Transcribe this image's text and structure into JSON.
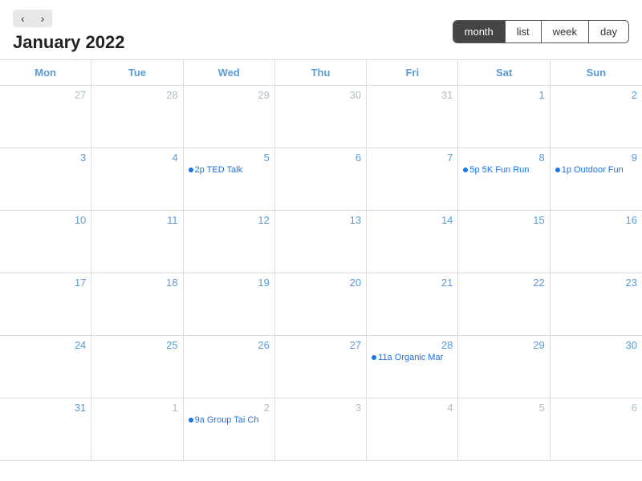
{
  "header": {
    "title": "January 2022",
    "nav": {
      "prev_label": "‹",
      "next_label": "›"
    },
    "view_buttons": [
      {
        "id": "month",
        "label": "month",
        "active": true
      },
      {
        "id": "list",
        "label": "list",
        "active": false
      },
      {
        "id": "week",
        "label": "week",
        "active": false
      },
      {
        "id": "day",
        "label": "day",
        "active": false
      }
    ]
  },
  "calendar": {
    "day_headers": [
      "Mon",
      "Tue",
      "Wed",
      "Thu",
      "Fri",
      "Sat",
      "Sun"
    ],
    "weeks": [
      [
        {
          "day": "27",
          "other": true,
          "events": []
        },
        {
          "day": "28",
          "other": true,
          "events": []
        },
        {
          "day": "29",
          "other": true,
          "events": []
        },
        {
          "day": "30",
          "other": true,
          "events": []
        },
        {
          "day": "31",
          "other": true,
          "events": []
        },
        {
          "day": "1",
          "other": false,
          "events": []
        },
        {
          "day": "2",
          "other": false,
          "events": []
        }
      ],
      [
        {
          "day": "3",
          "other": false,
          "events": []
        },
        {
          "day": "4",
          "other": false,
          "events": []
        },
        {
          "day": "5",
          "other": false,
          "events": [
            {
              "time": "2p",
              "name": "TED Talk"
            }
          ]
        },
        {
          "day": "6",
          "other": false,
          "events": []
        },
        {
          "day": "7",
          "other": false,
          "events": []
        },
        {
          "day": "8",
          "other": false,
          "events": [
            {
              "time": "5p",
              "name": "5K Fun Run"
            }
          ]
        },
        {
          "day": "9",
          "other": false,
          "events": [
            {
              "time": "1p",
              "name": "Outdoor Fun"
            }
          ]
        }
      ],
      [
        {
          "day": "10",
          "other": false,
          "events": []
        },
        {
          "day": "11",
          "other": false,
          "events": []
        },
        {
          "day": "12",
          "other": false,
          "events": []
        },
        {
          "day": "13",
          "other": false,
          "events": []
        },
        {
          "day": "14",
          "other": false,
          "events": []
        },
        {
          "day": "15",
          "other": false,
          "events": []
        },
        {
          "day": "16",
          "other": false,
          "events": []
        }
      ],
      [
        {
          "day": "17",
          "other": false,
          "events": []
        },
        {
          "day": "18",
          "other": false,
          "events": []
        },
        {
          "day": "19",
          "other": false,
          "events": []
        },
        {
          "day": "20",
          "other": false,
          "events": []
        },
        {
          "day": "21",
          "other": false,
          "events": []
        },
        {
          "day": "22",
          "other": false,
          "events": []
        },
        {
          "day": "23",
          "other": false,
          "events": []
        }
      ],
      [
        {
          "day": "24",
          "other": false,
          "events": []
        },
        {
          "day": "25",
          "other": false,
          "events": []
        },
        {
          "day": "26",
          "other": false,
          "events": []
        },
        {
          "day": "27",
          "other": false,
          "events": []
        },
        {
          "day": "28",
          "other": false,
          "events": [
            {
              "time": "11a",
              "name": "Organic Mar"
            }
          ]
        },
        {
          "day": "29",
          "other": false,
          "events": []
        },
        {
          "day": "30",
          "other": false,
          "events": []
        }
      ],
      [
        {
          "day": "31",
          "other": false,
          "events": []
        },
        {
          "day": "1",
          "other": true,
          "events": []
        },
        {
          "day": "2",
          "other": true,
          "events": [
            {
              "time": "9a",
              "name": "Group Tai Ch"
            }
          ]
        },
        {
          "day": "3",
          "other": true,
          "events": []
        },
        {
          "day": "4",
          "other": true,
          "events": []
        },
        {
          "day": "5",
          "other": true,
          "events": []
        },
        {
          "day": "6",
          "other": true,
          "events": []
        }
      ]
    ]
  }
}
